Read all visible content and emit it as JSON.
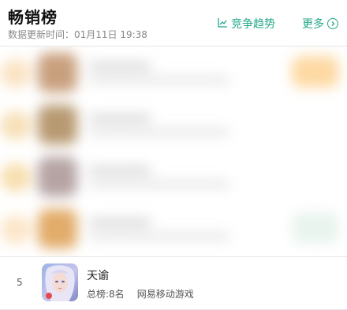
{
  "header": {
    "title": "畅销榜",
    "update_time": "数据更新时间：01月11日 19:38",
    "trend_label": "竞争趋势",
    "more_label": "更多"
  },
  "list": {
    "items": [
      {
        "rank": "5",
        "name": "天谕",
        "total_rank": "总榜:8名",
        "publisher": "网易移动游戏"
      }
    ]
  },
  "colors": {
    "accent": "#23a88a"
  }
}
